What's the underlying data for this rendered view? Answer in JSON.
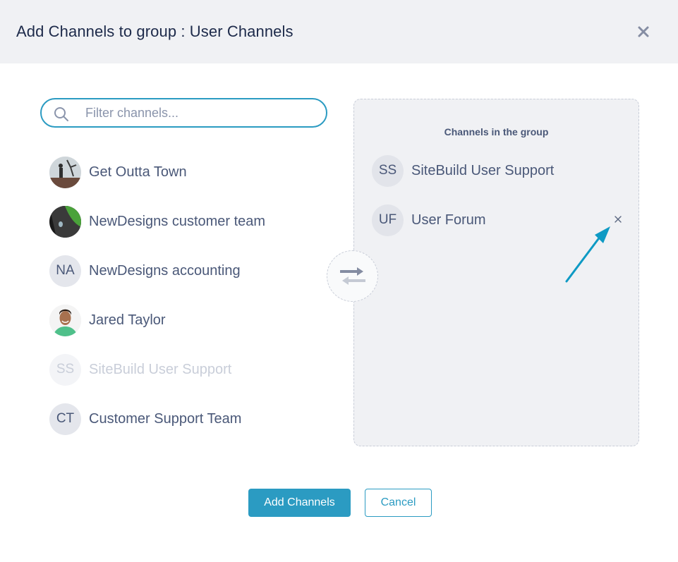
{
  "dialog": {
    "title": "Add Channels to group : User Channels",
    "close_icon": "close-icon"
  },
  "search": {
    "placeholder": "Filter channels...",
    "value": "",
    "icon": "search-icon"
  },
  "available_channels": [
    {
      "label": "Get Outta Town",
      "avatar_type": "photo",
      "initials": "",
      "disabled": false
    },
    {
      "label": "NewDesigns customer team",
      "avatar_type": "photo",
      "initials": "",
      "disabled": false
    },
    {
      "label": "NewDesigns accounting",
      "avatar_type": "initials",
      "initials": "NA",
      "disabled": false
    },
    {
      "label": "Jared Taylor",
      "avatar_type": "photo",
      "initials": "",
      "disabled": false
    },
    {
      "label": "SiteBuild User Support",
      "avatar_type": "initials",
      "initials": "SS",
      "disabled": true
    },
    {
      "label": "Customer Support Team",
      "avatar_type": "initials",
      "initials": "CT",
      "disabled": false
    }
  ],
  "transfer_icon": "swap-arrows-icon",
  "group": {
    "title": "Channels in the group",
    "items": [
      {
        "label": "SiteBuild User Support",
        "initials": "SS",
        "removable": false
      },
      {
        "label": "User Forum",
        "initials": "UF",
        "removable": true
      }
    ]
  },
  "annotation": {
    "icon": "pointer-arrow-icon",
    "color": "#0e9ac4"
  },
  "buttons": {
    "add": "Add Channels",
    "cancel": "Cancel"
  },
  "colors": {
    "accent": "#2b9bc2",
    "header_bg": "#f0f1f4",
    "text": "#4a5878",
    "title": "#1d2a4a"
  }
}
